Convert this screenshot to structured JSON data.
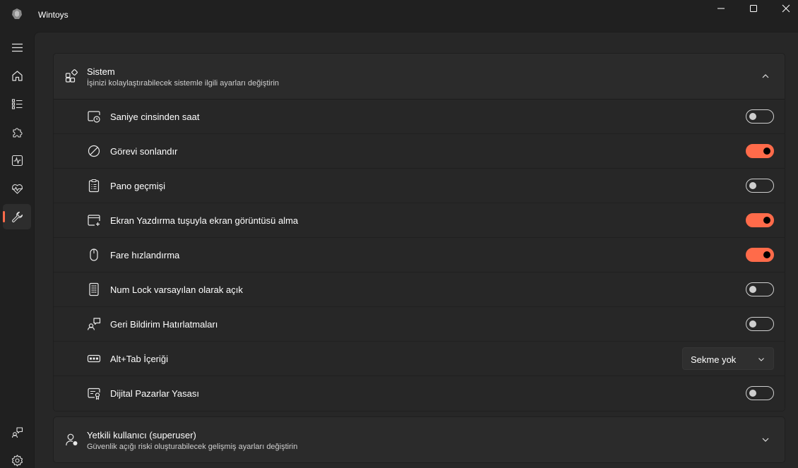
{
  "app": {
    "title": "Wintoys",
    "icon": "wintoys-logo-icon"
  },
  "window_controls": [
    {
      "name": "minimize-button",
      "icon": "minimize-icon"
    },
    {
      "name": "maximize-button",
      "icon": "maximize-icon"
    },
    {
      "name": "close-button",
      "icon": "close-icon"
    }
  ],
  "sidebar": {
    "items": [
      {
        "icon": "hamburger-menu-icon"
      },
      {
        "icon": "home-icon"
      },
      {
        "icon": "apps-list-icon"
      },
      {
        "icon": "puzzle-icon"
      },
      {
        "icon": "performance-icon"
      },
      {
        "icon": "health-icon"
      },
      {
        "icon": "wrench-icon",
        "active": true
      },
      {
        "icon": "feedback-icon"
      },
      {
        "icon": "settings-icon"
      }
    ],
    "accent_color": "#ff6b4a"
  },
  "sistem": {
    "title": "Sistem",
    "subtitle": "İşinizi kolaylaştırabilecek sistemle ilgili ayarları değiştirin",
    "expanded": true,
    "rows": [
      {
        "label": "Saniye cinsinden saat",
        "icon": "clock-window-icon",
        "toggle": false
      },
      {
        "label": "Görevi sonlandır",
        "icon": "prohibited-icon",
        "toggle": true
      },
      {
        "label": "Pano geçmişi",
        "icon": "clipboard-icon",
        "toggle": false
      },
      {
        "label": "Ekran Yazdırma tuşuyla ekran görüntüsü alma",
        "icon": "screenshot-icon",
        "toggle": true
      },
      {
        "label": "Fare hızlandırma",
        "icon": "mouse-icon",
        "toggle": true
      },
      {
        "label": "Num Lock varsayılan olarak açık",
        "icon": "numpad-icon",
        "toggle": false
      },
      {
        "label": "Geri Bildirim Hatırlatmaları",
        "icon": "feedback-person-icon",
        "toggle": false
      },
      {
        "label": "Alt+Tab İçeriği",
        "icon": "alt-tab-icon",
        "dropdown": "Sekme yok"
      },
      {
        "label": "Dijital Pazarlar Yasası",
        "icon": "certificate-icon",
        "toggle": false
      }
    ]
  },
  "superuser": {
    "title": "Yetkili kullanıcı (superuser)",
    "subtitle": "Güvenlik açığı riski oluşturabilecek gelişmiş ayarları değiştirin",
    "expanded": false,
    "icon": "superuser-icon"
  }
}
